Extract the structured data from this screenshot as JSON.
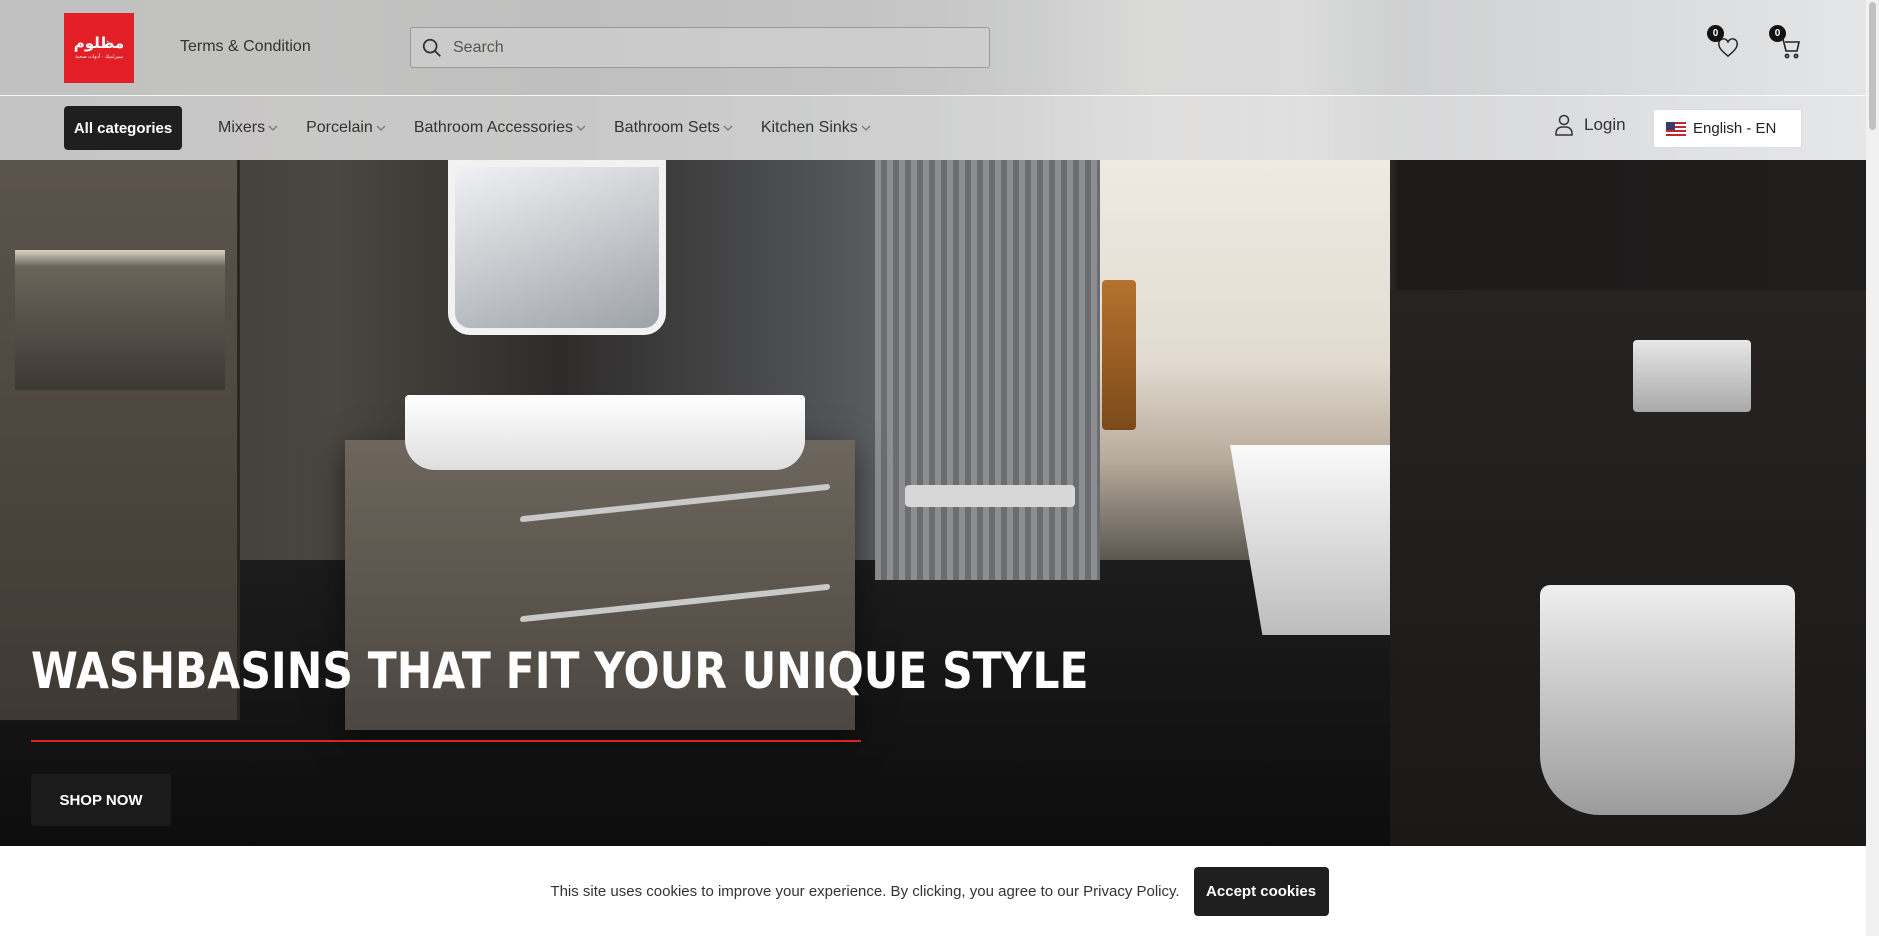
{
  "header": {
    "logo_text": "مظلوم",
    "logo_subtext": "سيراميك · أدوات صحية",
    "terms_link": "Terms & Condition",
    "search_placeholder": "Search",
    "wishlist_count": "0",
    "cart_count": "0"
  },
  "nav": {
    "all_categories": "All categories",
    "menu": [
      {
        "label": "Mixers",
        "icon": "chevron-down-icon"
      },
      {
        "label": "Porcelain",
        "icon": "chevron-down-icon"
      },
      {
        "label": "Bathroom Accessories",
        "icon": "chevron-down-icon"
      },
      {
        "label": "Bathroom Sets",
        "icon": "chevron-down-icon"
      },
      {
        "label": "Kitchen Sinks",
        "icon": "chevron-down-icon"
      }
    ],
    "login": "Login",
    "language": "English - EN"
  },
  "hero": {
    "title": "WASHBASINS THAT FIT YOUR UNIQUE STYLE",
    "cta": "SHOP NOW",
    "accent_color": "#e21f26"
  },
  "cookie": {
    "text": "This site uses cookies to improve your experience. By clicking, you agree to our Privacy Policy.",
    "button": "Accept cookies"
  },
  "colors": {
    "brand_red": "#e21f26",
    "dark_button": "#1f1f1f"
  }
}
